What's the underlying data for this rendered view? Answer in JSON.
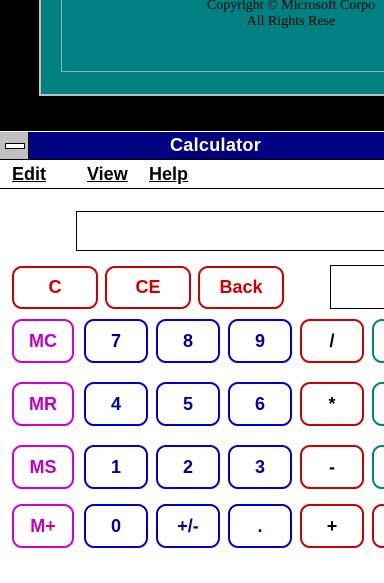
{
  "background_window": {
    "line1": "Copyright © Microsoft Corpo",
    "line2": "All Rights Rese"
  },
  "calculator": {
    "title": "Calculator",
    "menu": {
      "edit": "Edit",
      "view": "View",
      "help": "Help"
    },
    "display_value": "",
    "buttons": {
      "clear": "C",
      "clear_entry": "CE",
      "back": "Back",
      "mc": "MC",
      "mr": "MR",
      "ms": "MS",
      "mplus": "M+",
      "d7": "7",
      "d8": "8",
      "d9": "9",
      "d4": "4",
      "d5": "5",
      "d6": "6",
      "d1": "1",
      "d2": "2",
      "d3": "3",
      "d0": "0",
      "sign": "+/-",
      "decimal": ".",
      "divide": "/",
      "multiply": "*",
      "subtract": "-",
      "add": "+"
    }
  },
  "colors": {
    "title_bar": "#000080",
    "control_red": "#cc0000",
    "digit_blue": "#0000a0",
    "memory_magenta": "#c000c0",
    "function_teal": "#008080"
  }
}
